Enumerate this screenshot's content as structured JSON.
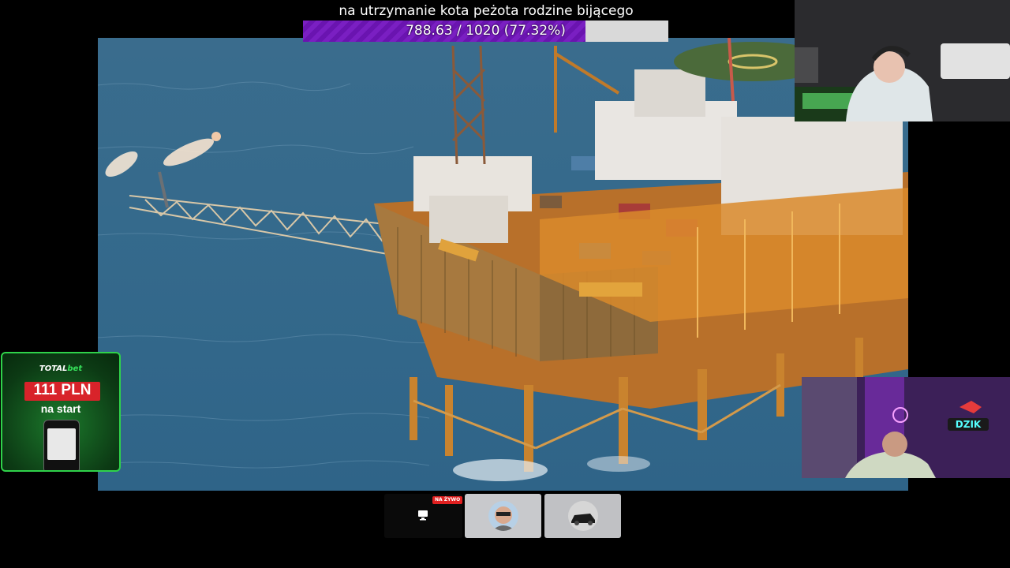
{
  "goal": {
    "title": "na utrzymanie kota peżota rodzine bijącego",
    "progress_text": "788.63 / 1020 (77.32%)",
    "progress_fraction": 0.7732,
    "fill_color": "#7a1fc2"
  },
  "sponsor": {
    "brand_part1": "TOTAL",
    "brand_part2": "bet",
    "amount": "111 PLN",
    "subtitle": "na start"
  },
  "participants": {
    "live_badge": "NA ŻYWO",
    "screen_share_icon": "monitor-icon",
    "user1_avatar": "person-avatar",
    "user2_avatar": "car-avatar"
  },
  "cam_bottom": {
    "sign": "DZIK"
  },
  "colors": {
    "sea": "#356a8c",
    "rig": "#d98a2b",
    "live": "#e02020",
    "sponsor_green": "#2fd24a",
    "sponsor_red": "#d8232a"
  }
}
